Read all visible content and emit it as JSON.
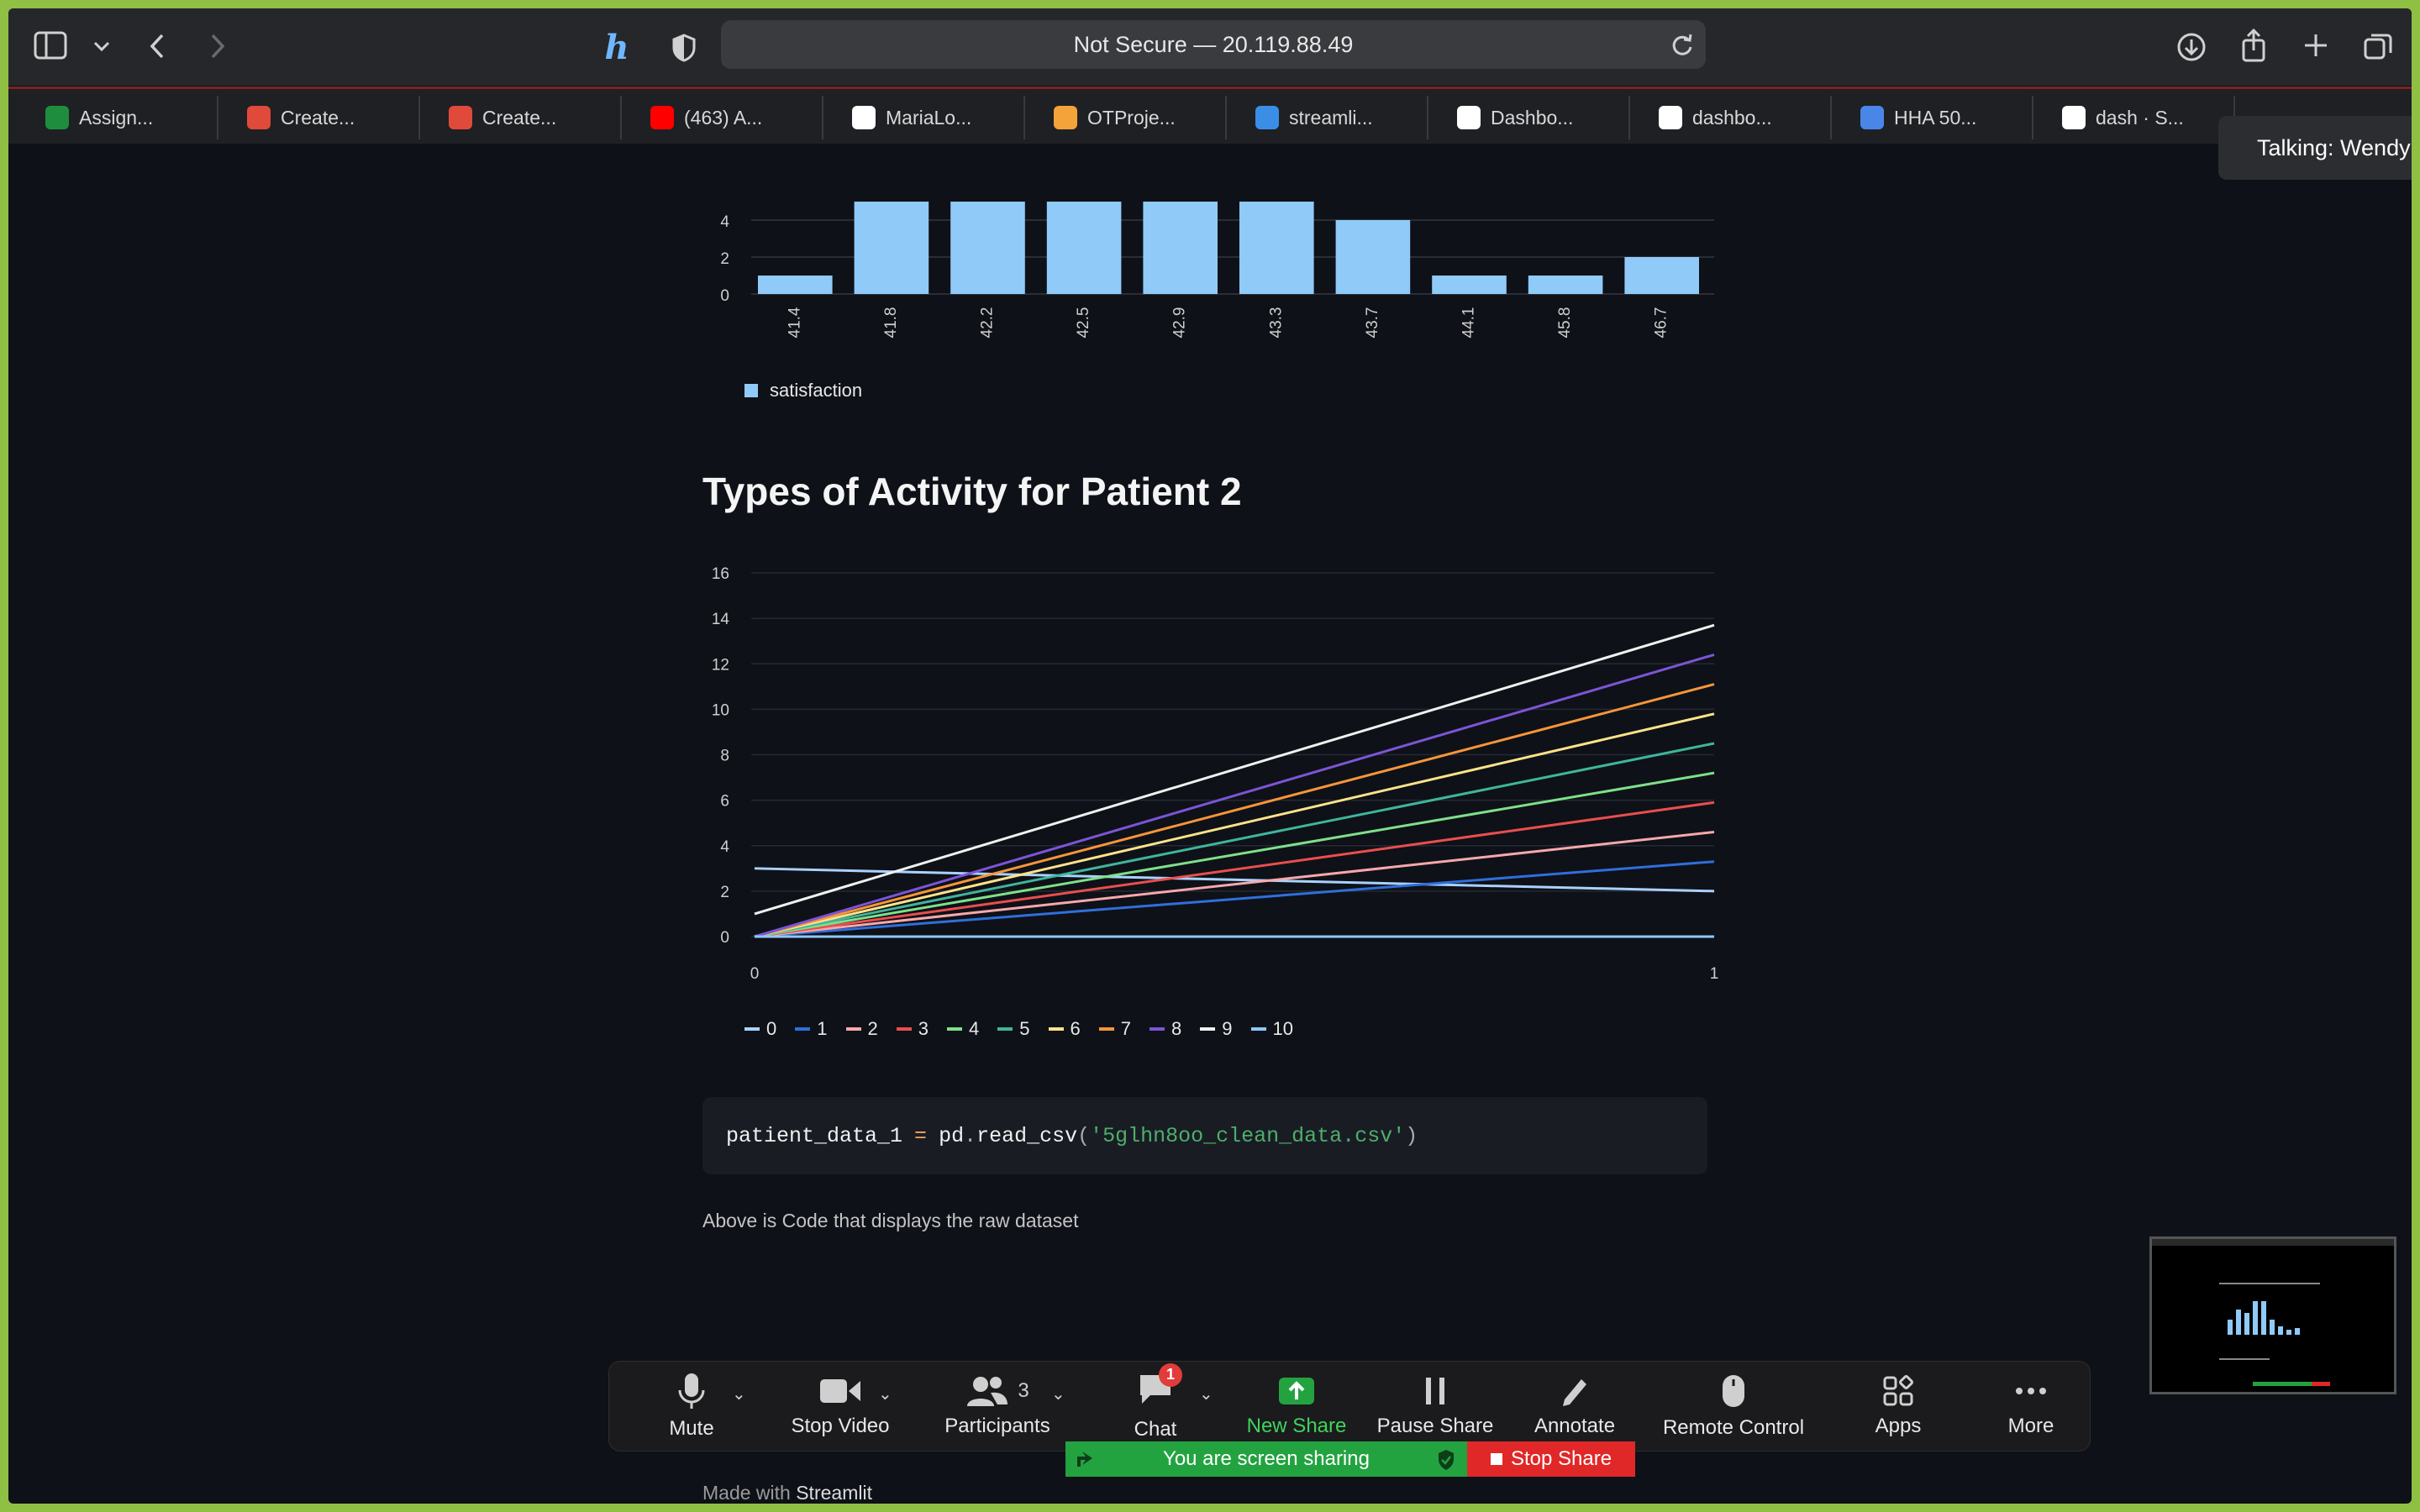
{
  "browser": {
    "url_text": "Not Secure — 20.119.88.49",
    "tabs": [
      {
        "label": "Assign...",
        "icon": "google-classroom-icon",
        "color": "#1e8e3e"
      },
      {
        "label": "Create...",
        "icon": "crown-icon",
        "color": "#e04a3a"
      },
      {
        "label": "Create...",
        "icon": "crown-icon",
        "color": "#e04a3a"
      },
      {
        "label": "(463) A...",
        "icon": "youtube-icon",
        "color": "#ff0000"
      },
      {
        "label": "MariaLo...",
        "icon": "github-icon",
        "color": "#ffffff"
      },
      {
        "label": "OTProje...",
        "icon": "infinity-icon",
        "color": "#f3a33a"
      },
      {
        "label": "streamli...",
        "icon": "azure-icon",
        "color": "#3a8ee6"
      },
      {
        "label": "Dashbo...",
        "icon": "github-icon",
        "color": "#ffffff"
      },
      {
        "label": "dashbo...",
        "icon": "github-icon",
        "color": "#ffffff"
      },
      {
        "label": "HHA 50...",
        "icon": "google-docs-icon",
        "color": "#4a86e8"
      },
      {
        "label": "dash · S...",
        "icon": "github-icon",
        "color": "#ffffff"
      }
    ],
    "tooltip": "Talking: Wendy A"
  },
  "bar_chart": {
    "chart_data": {
      "type": "bar",
      "categories": [
        "41.4",
        "41.8",
        "42.2",
        "42.5",
        "42.9",
        "43.3",
        "43.7",
        "44.1",
        "45.8",
        "46.7"
      ],
      "values": [
        1,
        5,
        5,
        5,
        5,
        5,
        4,
        1,
        1,
        2
      ],
      "yticks": [
        "0",
        "2",
        "4"
      ],
      "legend": "satisfaction",
      "color": "#90caf9"
    }
  },
  "line_chart": {
    "title": "Types of Activity for Patient 2",
    "chart_data": {
      "type": "line",
      "x": [
        0,
        1
      ],
      "xticks": [
        "0",
        "1"
      ],
      "yticks": [
        "0",
        "2",
        "4",
        "6",
        "8",
        "10",
        "12",
        "14",
        "16"
      ],
      "ylim": [
        0,
        16
      ],
      "series": [
        {
          "name": "0",
          "values": [
            3.0,
            2.0
          ],
          "color": "#a9d2ff"
        },
        {
          "name": "1",
          "values": [
            0,
            3.3
          ],
          "color": "#2f6fdc"
        },
        {
          "name": "2",
          "values": [
            0,
            4.6
          ],
          "color": "#f6a8ac"
        },
        {
          "name": "3",
          "values": [
            0,
            5.9
          ],
          "color": "#ea4e4e"
        },
        {
          "name": "4",
          "values": [
            0,
            7.2
          ],
          "color": "#7ee08a"
        },
        {
          "name": "5",
          "values": [
            0,
            8.5
          ],
          "color": "#3fb59c"
        },
        {
          "name": "6",
          "values": [
            0,
            9.8
          ],
          "color": "#fde38a"
        },
        {
          "name": "7",
          "values": [
            0,
            11.1
          ],
          "color": "#f7953a"
        },
        {
          "name": "8",
          "values": [
            0,
            12.4
          ],
          "color": "#7b55d6"
        },
        {
          "name": "9",
          "values": [
            1.0,
            13.7
          ],
          "color": "#f0f0f0"
        },
        {
          "name": "10",
          "values": [
            0,
            0
          ],
          "color": "#8ec8ff"
        }
      ]
    }
  },
  "code": {
    "var": "patient_data_1",
    "op": "=",
    "obj": "pd",
    "func": "read_csv",
    "arg": "'5glhn8oo_clean_data.csv'"
  },
  "caption": "Above is Code that displays the raw dataset",
  "footer": {
    "prefix": "Made with",
    "brand": "Streamlit"
  },
  "zoom": {
    "mute": "Mute",
    "stop_video": "Stop Video",
    "participants": "Participants",
    "participants_count": "3",
    "chat": "Chat",
    "chat_badge": "1",
    "new_share": "New Share",
    "pause_share": "Pause Share",
    "annotate": "Annotate",
    "remote_control": "Remote Control",
    "apps": "Apps",
    "more": "More",
    "sharing_banner": "You are screen sharing",
    "stop_share": "Stop Share"
  }
}
